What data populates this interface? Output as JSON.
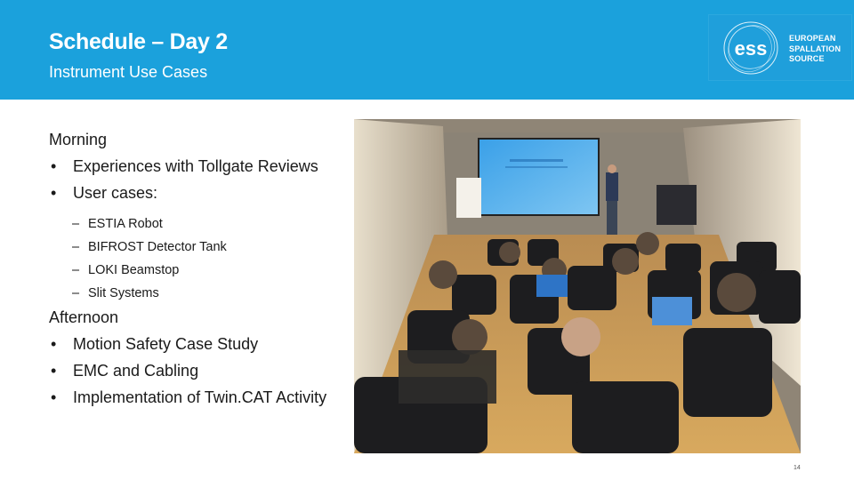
{
  "header": {
    "title": "Schedule – Day 2",
    "subtitle": "Instrument Use Cases",
    "background_color": "#1ba1dc"
  },
  "logo": {
    "mark_text": "ess",
    "lines": [
      "EUROPEAN",
      "SPALLATION",
      "SOURCE"
    ],
    "icon": "ess-logo-icon"
  },
  "morning": {
    "heading": "Morning",
    "items": [
      {
        "label": "Experiences with Tollgate Reviews"
      },
      {
        "label": "User cases:",
        "subitems": [
          "ESTIA Robot",
          "BIFROST Detector Tank",
          "LOKI Beamstop",
          "Slit Systems"
        ]
      }
    ]
  },
  "afternoon": {
    "heading": "Afternoon",
    "items": [
      {
        "label": "Motion Safety Case Study"
      },
      {
        "label": "EMC and Cabling"
      },
      {
        "label": "Implementation of Twin.CAT Activity"
      }
    ]
  },
  "bullet_glyph": "•",
  "dash_glyph": "–",
  "photo": {
    "description": "Audience seated in a lecture room watching a presenter in front of a projection screen",
    "icon": "meeting-photo"
  },
  "page_number": "14"
}
